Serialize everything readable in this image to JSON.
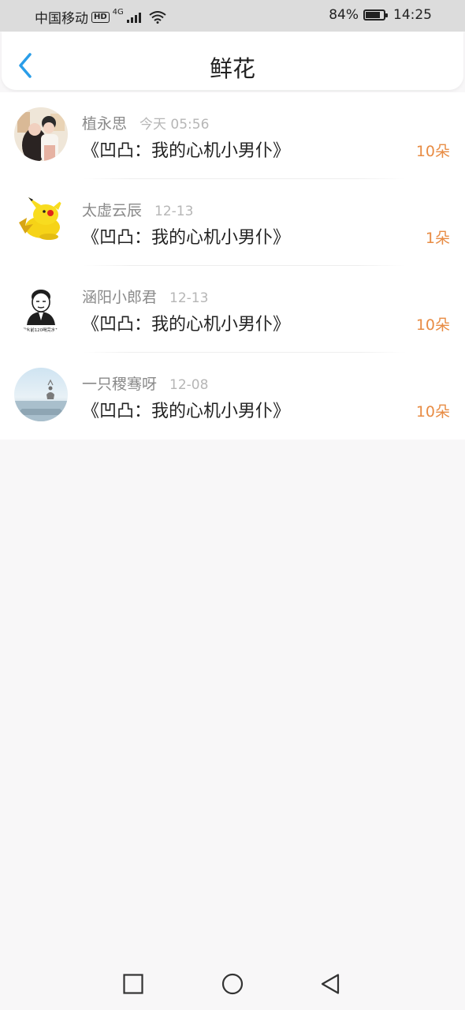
{
  "status_bar": {
    "carrier": "中国移动",
    "hd": "HD",
    "network": "4G",
    "battery_percent": "84%",
    "battery_level": 0.84,
    "time": "14:25"
  },
  "header": {
    "title": "鲜花",
    "back_icon": "chevron-left-icon",
    "accent_color": "#2a9de8"
  },
  "flower_records": [
    {
      "username": "植永思",
      "time": "今天 05:56",
      "work_title": "《凹凸：我的心机小男仆》",
      "count": "10朵"
    },
    {
      "username": "太虚云辰",
      "time": "12-13",
      "work_title": "《凹凸：我的心机小男仆》",
      "count": "1朵"
    },
    {
      "username": "涵阳小郎君",
      "time": "12-13",
      "work_title": "《凹凸：我的心机小男仆》",
      "count": "10朵"
    },
    {
      "username": "一只稷骞呀",
      "time": "12-08",
      "work_title": "《凹凸：我的心机小男仆》",
      "count": "10朵"
    }
  ],
  "avatar_badges": {
    "meme_caption": "喝水前120喝完水1?"
  },
  "colors": {
    "count_orange": "#e88c44",
    "username_gray": "#8a8a8a",
    "time_gray": "#b6b6b6"
  },
  "nav_bar": {
    "recent_icon": "square-icon",
    "home_icon": "circle-icon",
    "back_icon": "triangle-back-icon"
  }
}
